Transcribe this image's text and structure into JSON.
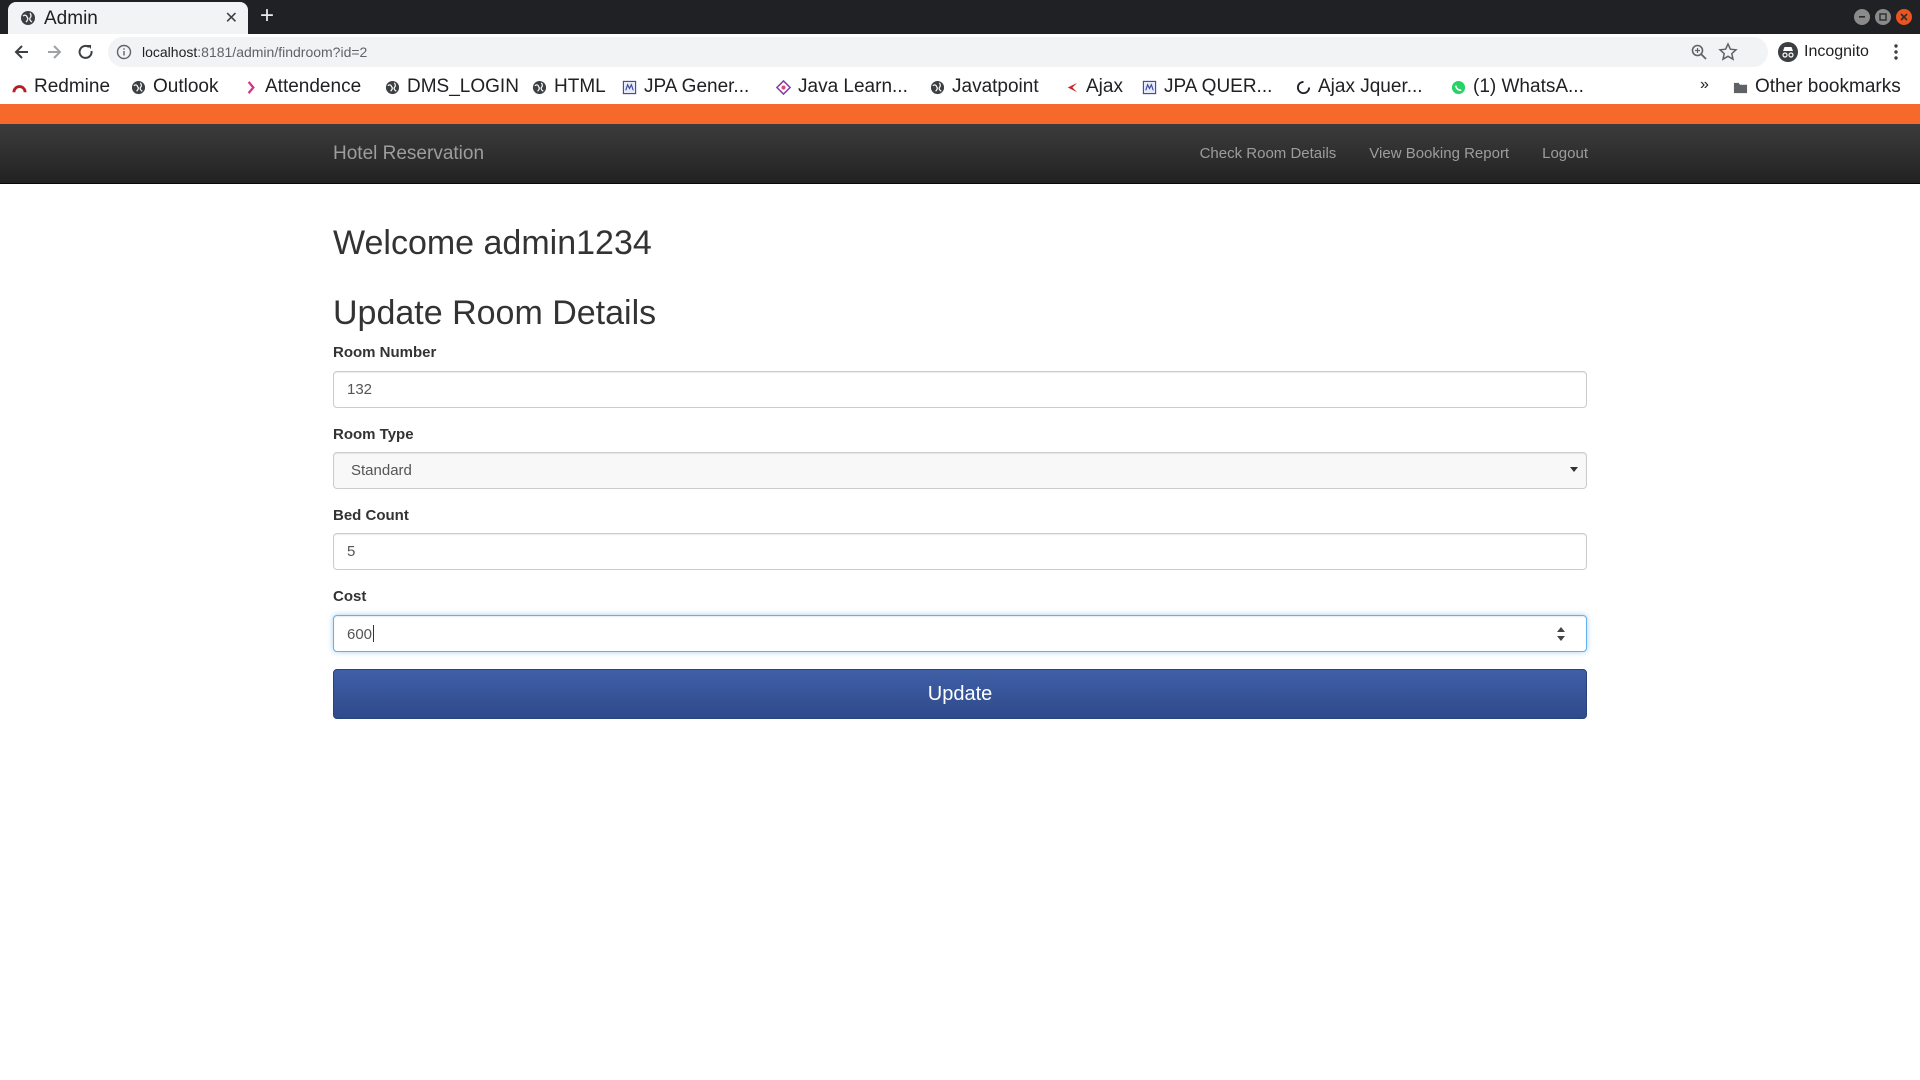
{
  "browser": {
    "tab_title": "Admin",
    "new_tab": "+",
    "url_host": "localhost",
    "url_path": ":8181/admin/findroom?id=2",
    "incognito_label": "Incognito",
    "bookmarks": [
      {
        "label": "Redmine",
        "icon": "redmine-icon"
      },
      {
        "label": "Outlook",
        "icon": "globe-icon"
      },
      {
        "label": "Attendence",
        "icon": "attendence-icon"
      },
      {
        "label": "DMS_LOGIN",
        "icon": "globe-icon"
      },
      {
        "label": "HTML",
        "icon": "globe-icon"
      },
      {
        "label": "JPA Gener...",
        "icon": "page-icon"
      },
      {
        "label": "Java Learn...",
        "icon": "java-icon"
      },
      {
        "label": "Javatpoint",
        "icon": "globe-icon"
      },
      {
        "label": "Ajax",
        "icon": "ajax-icon"
      },
      {
        "label": "JPA QUER...",
        "icon": "page-icon"
      },
      {
        "label": "Ajax Jquer...",
        "icon": "spinner-icon"
      },
      {
        "label": "(1) WhatsA...",
        "icon": "whatsapp-icon"
      }
    ],
    "overflow": "»",
    "other_bookmarks": "Other bookmarks"
  },
  "nav": {
    "brand": "Hotel Reservation",
    "links": [
      "Check Room Details",
      "View Booking Report",
      "Logout"
    ]
  },
  "page": {
    "welcome": "Welcome admin1234",
    "form_title": "Update Room Details",
    "fields": {
      "room_number": {
        "label": "Room Number",
        "value": "132"
      },
      "room_type": {
        "label": "Room Type",
        "value": "Standard"
      },
      "bed_count": {
        "label": "Bed Count",
        "value": "5"
      },
      "cost": {
        "label": "Cost",
        "value": "600"
      }
    },
    "submit_label": "Update"
  },
  "colors": {
    "accent_bar": "#f7692a",
    "navbar": "#222222",
    "button": "#2f4a8c"
  }
}
